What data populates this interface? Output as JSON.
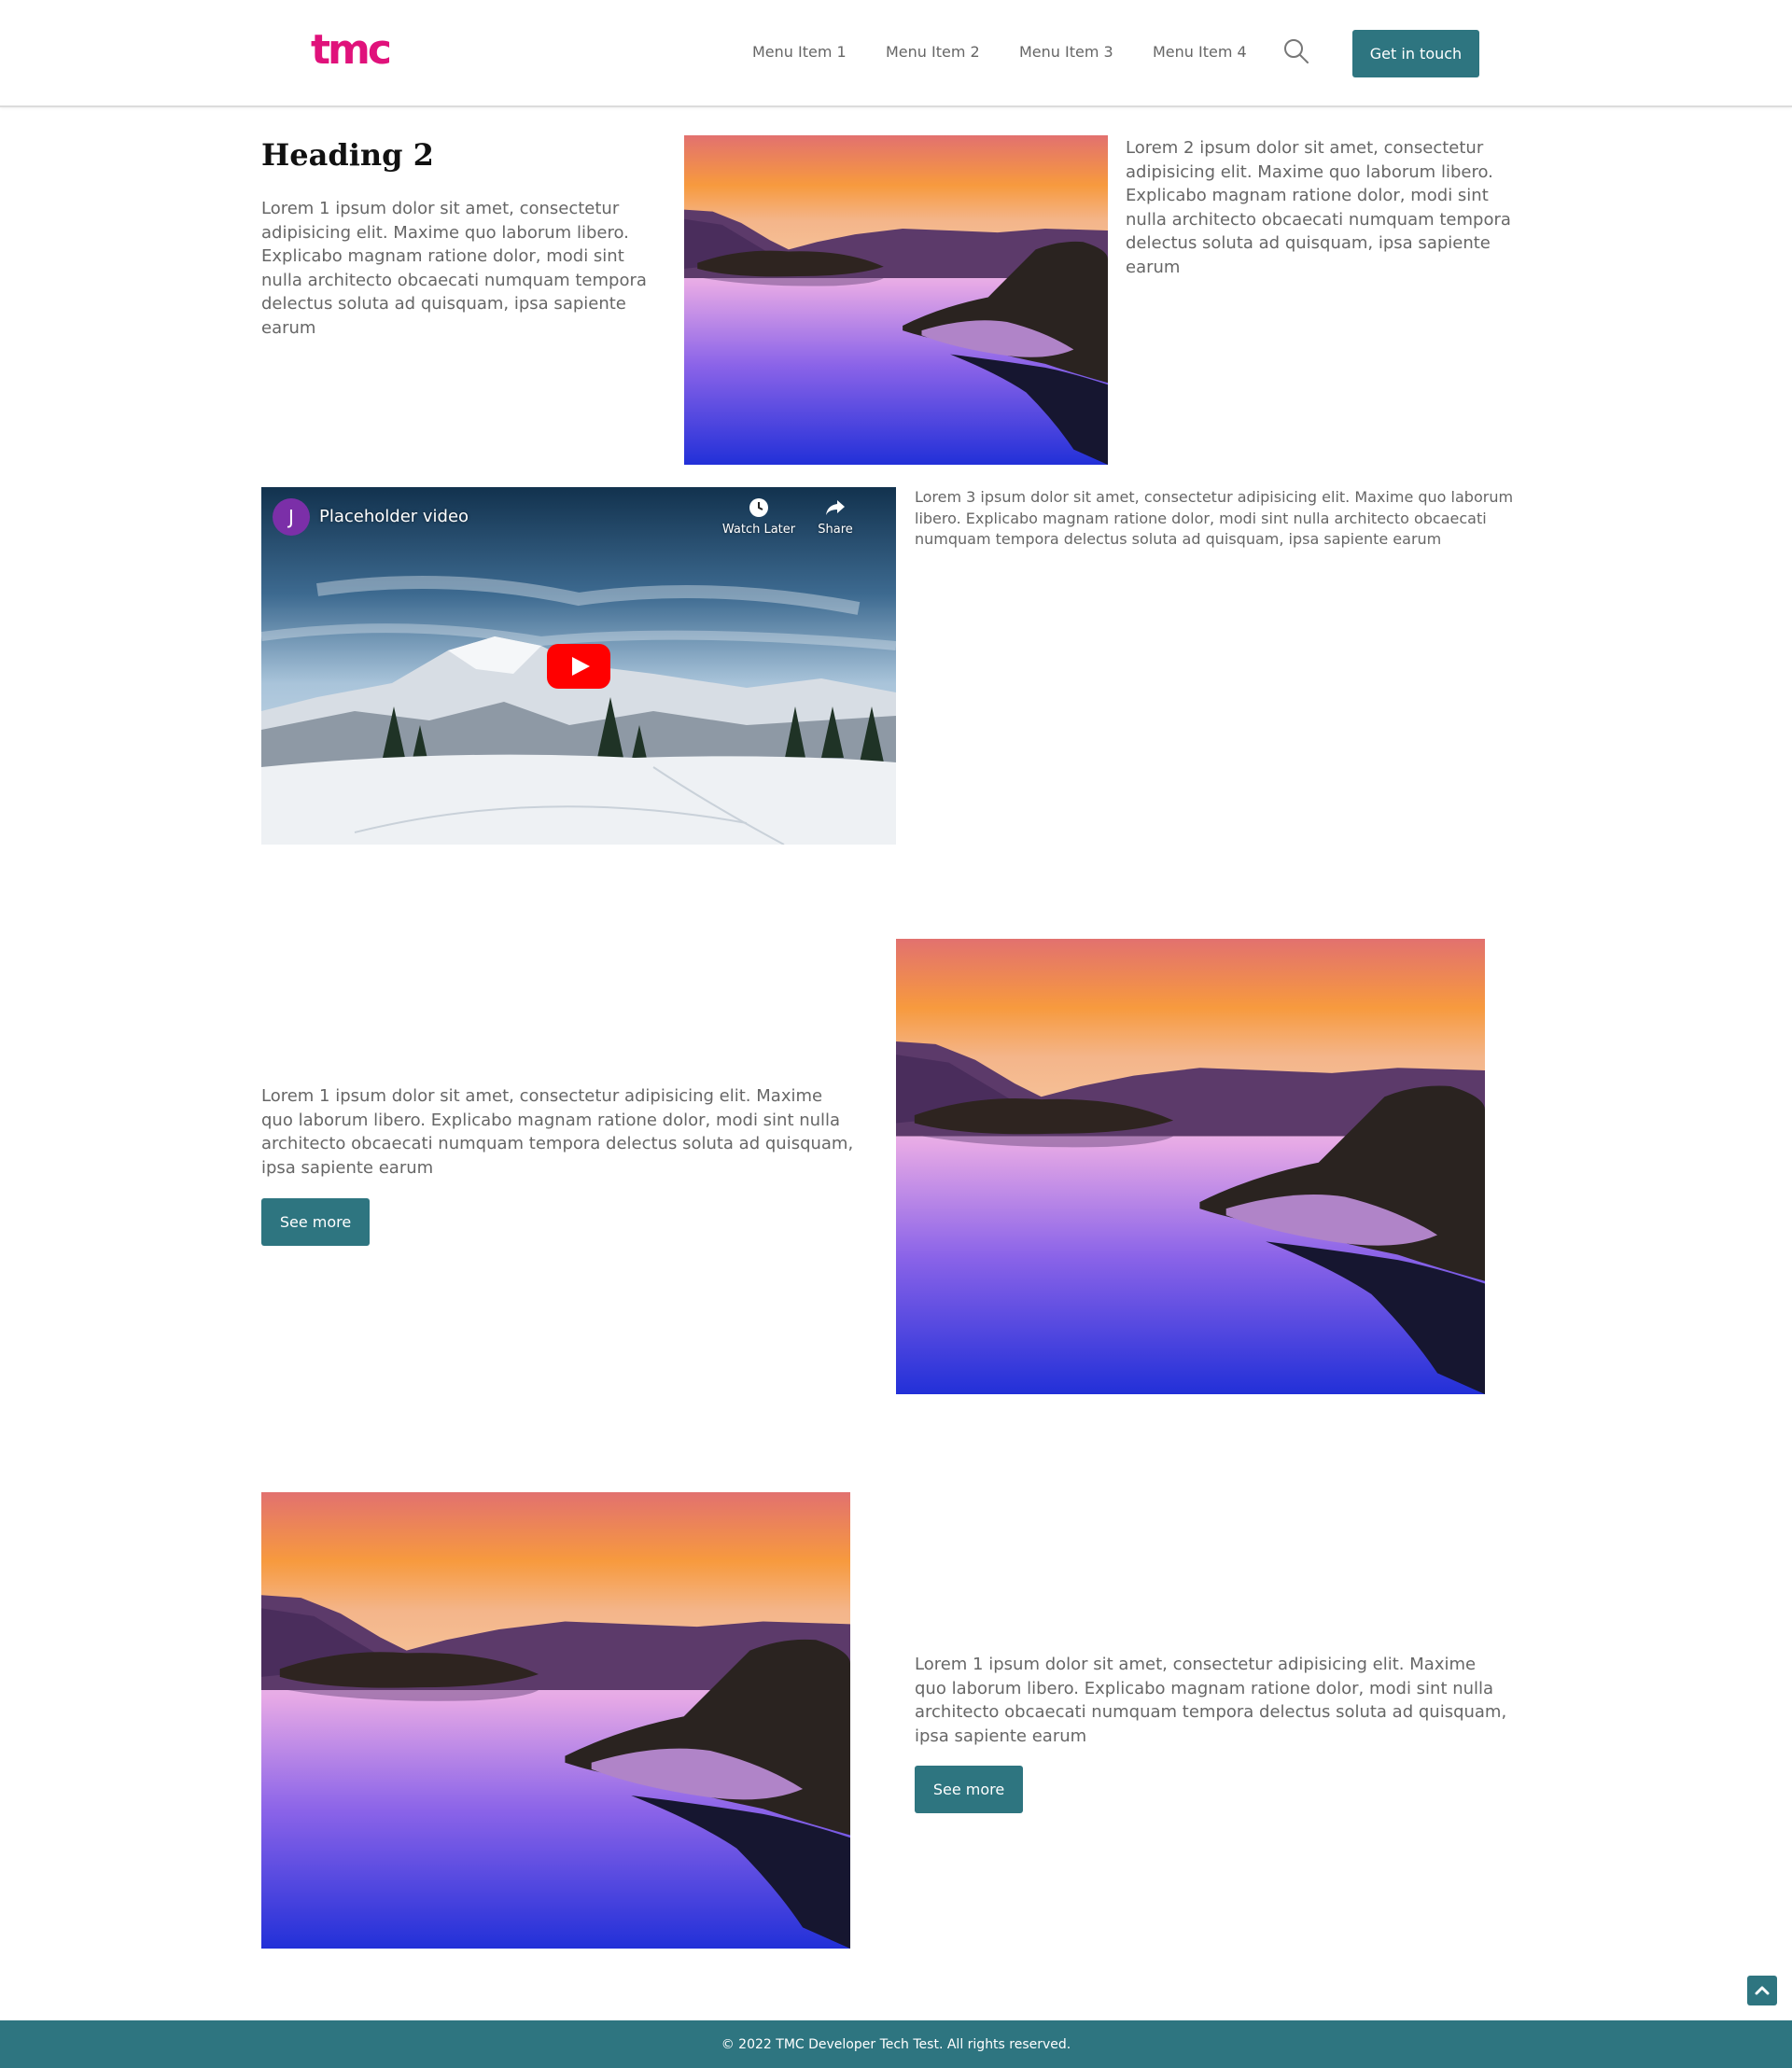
{
  "header": {
    "logo": "tmc",
    "nav": [
      "Menu Item 1",
      "Menu Item 2",
      "Menu Item 3",
      "Menu Item 4"
    ],
    "cta": "Get in touch",
    "search_icon": "search-icon"
  },
  "section1": {
    "heading": "Heading 2",
    "text_left": "Lorem 1 ipsum dolor sit amet, consectetur adipisicing elit. Maxime quo laborum libero. Explicabo magnam ratione dolor, modi sint nulla architecto obcaecati numquam tempora delectus soluta ad quisquam, ipsa sapiente earum",
    "text_right": "Lorem 2 ipsum dolor sit amet, consectetur adipisicing elit. Maxime quo laborum libero. Explicabo magnam ratione dolor, modi sint nulla architecto obcaecati numquam tempora delectus soluta ad quisquam, ipsa sapiente earum"
  },
  "video": {
    "avatar_letter": "J",
    "title": "Placeholder video",
    "watch_later": "Watch Later",
    "share": "Share",
    "side_text": "Lorem 3 ipsum dolor sit amet, consectetur adipisicing elit. Maxime quo laborum libero. Explicabo magnam ratione dolor, modi sint nulla architecto obcaecati numquam tempora delectus soluta ad quisquam, ipsa sapiente earum"
  },
  "section3": {
    "text": "Lorem 1 ipsum dolor sit amet, consectetur adipisicing elit. Maxime quo laborum libero. Explicabo magnam ratione dolor, modi sint nulla architecto obcaecati numquam tempora delectus soluta ad quisquam, ipsa sapiente earum",
    "button": "See more"
  },
  "section4": {
    "text": "Lorem 1 ipsum dolor sit amet, consectetur adipisicing elit. Maxime quo laborum libero. Explicabo magnam ratione dolor, modi sint nulla architecto obcaecati numquam tempora delectus soluta ad quisquam, ipsa sapiente earum",
    "button": "See more"
  },
  "footer": {
    "text": "© 2022 TMC Developer Tech Test. All rights reserved."
  },
  "colors": {
    "brand": "#e0127b",
    "accent": "#2e7580"
  }
}
